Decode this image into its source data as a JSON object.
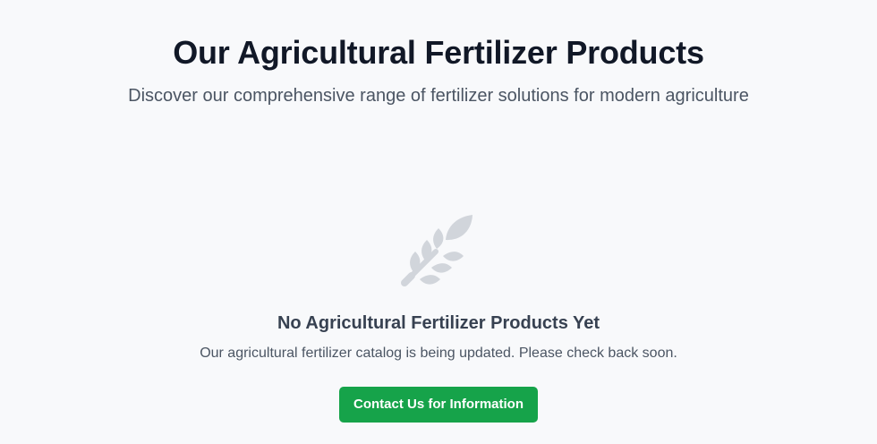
{
  "header": {
    "title": "Our Agricultural Fertilizer Products",
    "subtitle": "Discover our comprehensive range of fertilizer solutions for modern agriculture"
  },
  "empty_state": {
    "icon": "wheat-icon",
    "title": "No Agricultural Fertilizer Products Yet",
    "message": "Our agricultural fertilizer catalog is being updated. Please check back soon.",
    "cta_label": "Contact Us for Information"
  },
  "colors": {
    "background": "#f8f9fb",
    "title": "#111827",
    "subtitle": "#4b5563",
    "icon": "#d1d5db",
    "button": "#16a34a",
    "button_text": "#ffffff"
  }
}
